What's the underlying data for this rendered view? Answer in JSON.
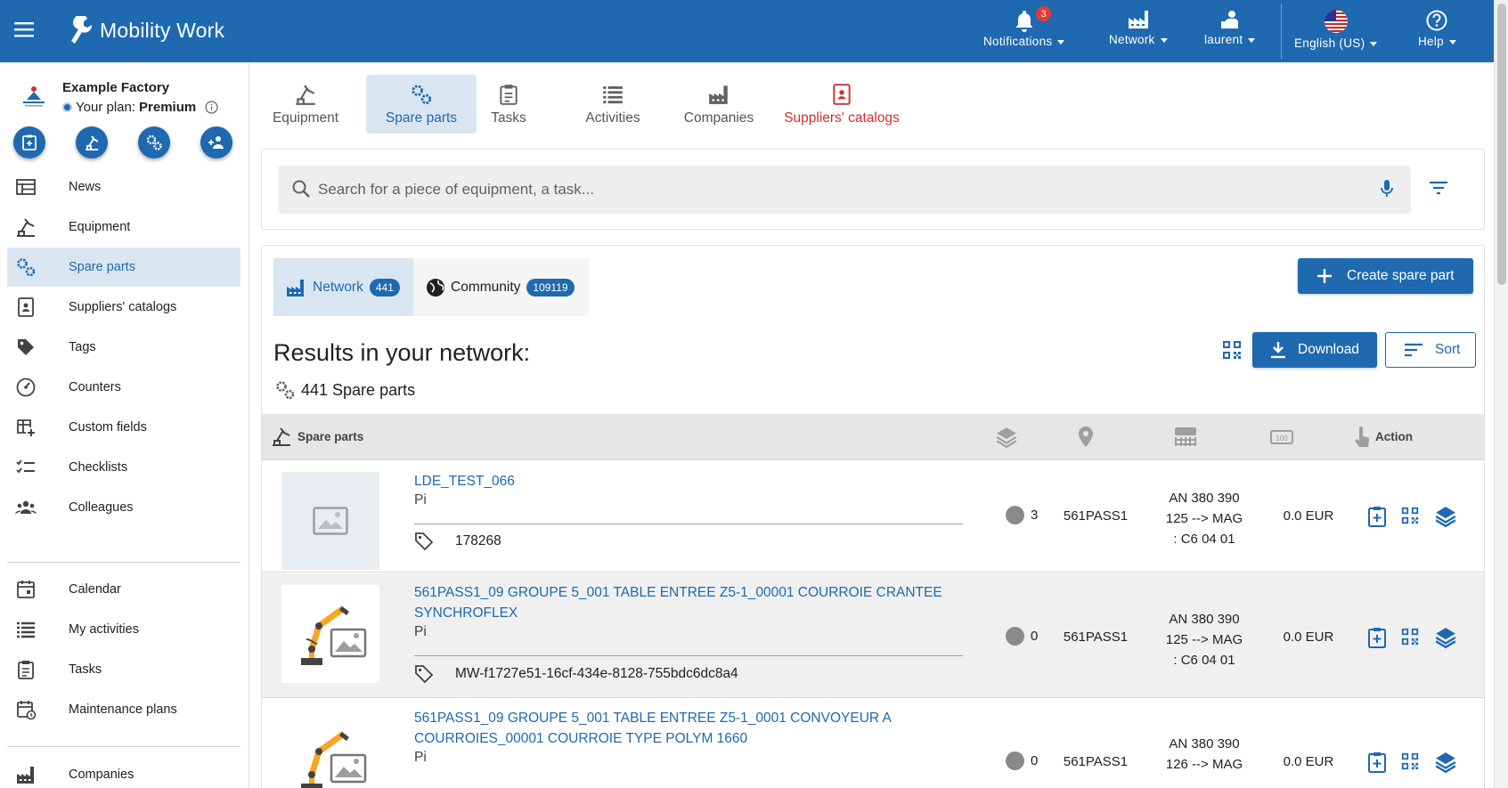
{
  "header": {
    "app_name": "Mobility Work",
    "notifications": {
      "label": "Notifications",
      "count": "3"
    },
    "network": {
      "label": "Network"
    },
    "user": {
      "label": "laurent"
    },
    "language": {
      "label": "English (US)"
    },
    "help": {
      "label": "Help"
    }
  },
  "sidebar": {
    "factory_name": "Example Factory",
    "plan_prefix": "Your plan:",
    "plan_name": "Premium",
    "items": [
      {
        "label": "News",
        "icon": "news-icon"
      },
      {
        "label": "Equipment",
        "icon": "equipment-icon"
      },
      {
        "label": "Spare parts",
        "icon": "spare-parts-icon",
        "active": true
      },
      {
        "label": "Suppliers' catalogs",
        "icon": "catalog-icon"
      },
      {
        "label": "Tags",
        "icon": "tag-icon"
      },
      {
        "label": "Counters",
        "icon": "counter-icon"
      },
      {
        "label": "Custom fields",
        "icon": "custom-fields-icon"
      },
      {
        "label": "Checklists",
        "icon": "checklist-icon"
      },
      {
        "label": "Colleagues",
        "icon": "colleagues-icon"
      },
      {
        "label": "Calendar",
        "icon": "calendar-icon"
      },
      {
        "label": "My activities",
        "icon": "activities-icon"
      },
      {
        "label": "Tasks",
        "icon": "tasks-icon"
      },
      {
        "label": "Maintenance plans",
        "icon": "maintenance-plan-icon"
      },
      {
        "label": "Companies",
        "icon": "companies-icon"
      }
    ]
  },
  "tabs": [
    {
      "label": "Equipment"
    },
    {
      "label": "Spare parts",
      "active": true
    },
    {
      "label": "Tasks"
    },
    {
      "label": "Activities"
    },
    {
      "label": "Companies"
    },
    {
      "label": "Suppliers' catalogs",
      "color": "#d32f2f"
    }
  ],
  "search": {
    "placeholder": "Search for a piece of equipment, a task..."
  },
  "results": {
    "network_label": "Network",
    "network_count": "441",
    "community_label": "Community",
    "community_count": "109119",
    "create_label": "Create spare part",
    "title": "Results in your network:",
    "count_text": "441 Spare parts",
    "download_label": "Download",
    "sort_label": "Sort",
    "columns": {
      "name": "Spare parts",
      "action": "Action"
    },
    "rows": [
      {
        "title": "LDE_TEST_066",
        "unit": "Pi",
        "tag": "178268",
        "qty": "3",
        "location": "561PASS1",
        "ref_lines": [
          "AN 380 390",
          "125 --> MAG",
          ": C6 04 01"
        ],
        "price": "0.0 EUR",
        "image": "placeholder"
      },
      {
        "title": "561PASS1_09 GROUPE 5_001 TABLE ENTREE Z5-1_00001 COURROIE CRANTEE SYNCHROFLEX",
        "unit": "Pi",
        "tag": "MW-f1727e51-16cf-434e-8128-755bdc6dc8a4",
        "qty": "0",
        "location": "561PASS1",
        "ref_lines": [
          "AN 380 390",
          "125 --> MAG",
          ": C6 04 01"
        ],
        "price": "0.0 EUR",
        "image": "robot"
      },
      {
        "title": "561PASS1_09 GROUPE 5_001 TABLE ENTREE Z5-1_0001 CONVOYEUR A COURROIES_00001 COURROIE TYPE POLYM 1660",
        "unit": "Pi",
        "qty": "0",
        "location": "561PASS1",
        "ref_lines": [
          "AN 380 390",
          "126 --> MAG"
        ],
        "price": "0.0 EUR",
        "image": "robot"
      }
    ]
  },
  "colors": {
    "brand": "#1e69b0",
    "active_bg": "#d9e6f2",
    "alert": "#e53935",
    "catalog_red": "#d32f2f"
  }
}
